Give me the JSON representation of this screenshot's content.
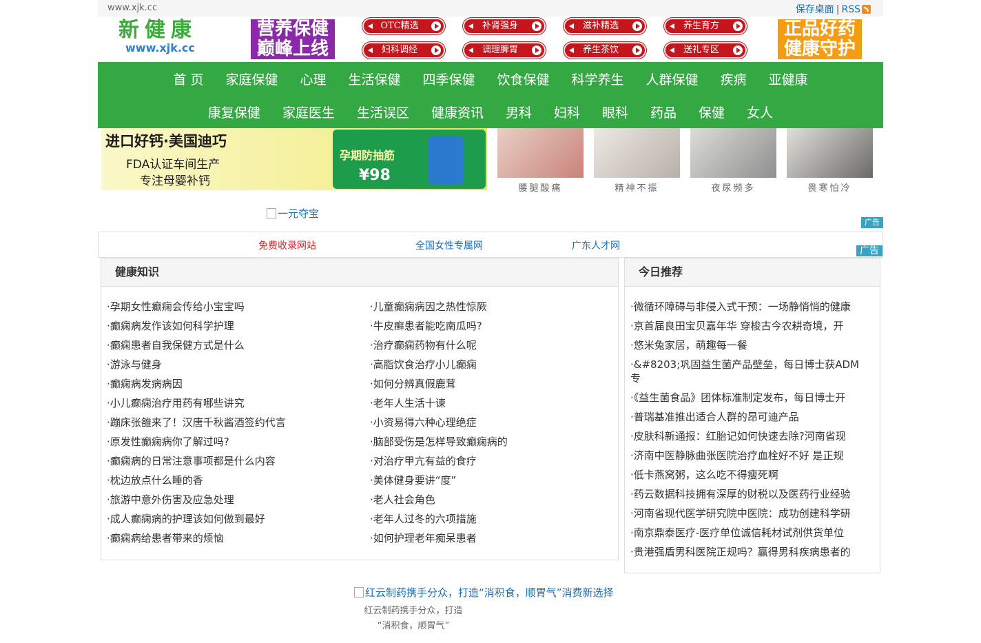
{
  "topbar": {
    "site": "www.xjk.cc",
    "save_desktop": "保存桌面",
    "separator": "|",
    "rss": "RSS"
  },
  "logo": {
    "cn": "新健康",
    "en": "www.xjk.cc"
  },
  "header_ads": {
    "left_l1": "营养保健",
    "left_l2": "巅峰上线",
    "right_l1": "正品好药",
    "right_l2": "健康守护"
  },
  "pills": [
    "OTC精选",
    "补肾强身",
    "滋补精选",
    "养生育方",
    "妇科调经",
    "调理脾胃",
    "养生茶饮",
    "送礼专区"
  ],
  "nav": {
    "row1": [
      "首 页",
      "家庭保健",
      "心理",
      "生活保健",
      "四季保健",
      "饮食保健",
      "科学养生",
      "人群保健",
      "疾病",
      "亚健康"
    ],
    "row2": [
      "康复保健",
      "家庭医生",
      "生活误区",
      "健康资讯",
      "男科",
      "妇科",
      "眼科",
      "药品",
      "保健",
      "女人"
    ]
  },
  "banner": {
    "title": "进口好钙·美国迪巧",
    "line2": "FDA认证车间生产",
    "line3": "专注母婴补钙",
    "promo": "孕期防抽筋",
    "price": "¥98",
    "thumbs": [
      "腰腿酸痛",
      "精神不振",
      "夜尿频多",
      "畏寒怕冷"
    ]
  },
  "ad_link": "一元夺宝",
  "ad_badge": "广告",
  "friend_links": [
    {
      "label": "免费收录网站",
      "color": "#d9232b"
    },
    {
      "label": "全国女性专属网",
      "color": "#1a6fb5"
    },
    {
      "label": "广东人才网",
      "color": "#1a6fb5"
    }
  ],
  "knowledge": {
    "title": "健康知识",
    "col1": [
      "·孕期女性癫痫会传给小宝宝吗",
      "·癫痫病发作该如何科学护理",
      "·癫痫患者自我保健方式是什么",
      "·游泳与健身",
      "·癫痫病发病病因",
      "·小儿癫痫治疗用药有哪些讲究",
      "·蹦床张雒来了！汉唐千秋酱酒签约代言",
      "·原发性癫痫病你了解过吗?",
      "·癫痫病的日常注意事项都是什么内容",
      "·枕边放点什么睡的香",
      "·旅游中意外伤害及应急处理",
      "·成人癫痫病的护理该如何做到最好",
      "·癫痫病给患者带来的烦恼"
    ],
    "col2": [
      "·儿童癫痫病因之热性惊厥",
      "·牛皮癣患者能吃南瓜吗?",
      "·治疗癫痫药物有什么呢",
      "·高脂饮食治疗小儿癫痫",
      "·如何分辨真假鹿茸",
      "·老年人生活十谏",
      "·小资易得六种心理绝症",
      "·脑部受伤是怎样导致癫痫病的",
      "·对治疗甲亢有益的食疗",
      "·美体健身要讲“度”",
      "·老人社会角色",
      "·老年人过冬的六项措施",
      "·如何护理老年痴呆患者"
    ]
  },
  "today": {
    "title": "今日推荐",
    "items": [
      "·微循环障碍与非侵入式干预：一场静悄悄的健康",
      "·京首届良田宝贝嘉年华 穿梭古今农耕奇境，开",
      "·悠米兔家居，萌趣每一餐",
      "·&#8203;巩固益生菌产品壁垒，每日博士获ADM",
      "专",
      "·《益生菌食品》团体标准制定发布，每日博士开",
      "·普瑞基准推出适合人群的昂可迪产品",
      "·皮肤科新通报：红胎记如何快速去除?河南省现",
      "·济南中医静脉曲张医院治疗血栓好不好 是正规",
      "·低卡燕窝粥，这么吃不得瘦死啊",
      "·药云数据科技拥有深厚的财税以及医药行业经验",
      "·河南省现代医学研究院中医院：成功创建科学研",
      "·南京鼎泰医疗-医疗单位诚信耗材试剂供货单位",
      "·贵港强盾男科医院正规吗？赢得男科疾病患者的"
    ]
  },
  "footer": {
    "link": "红云制药携手分众，打造“消积食，顺胃气”消费新选择",
    "cap1": "红云制药携手分众，打造",
    "cap2": "“消积食，顺胃气”"
  }
}
